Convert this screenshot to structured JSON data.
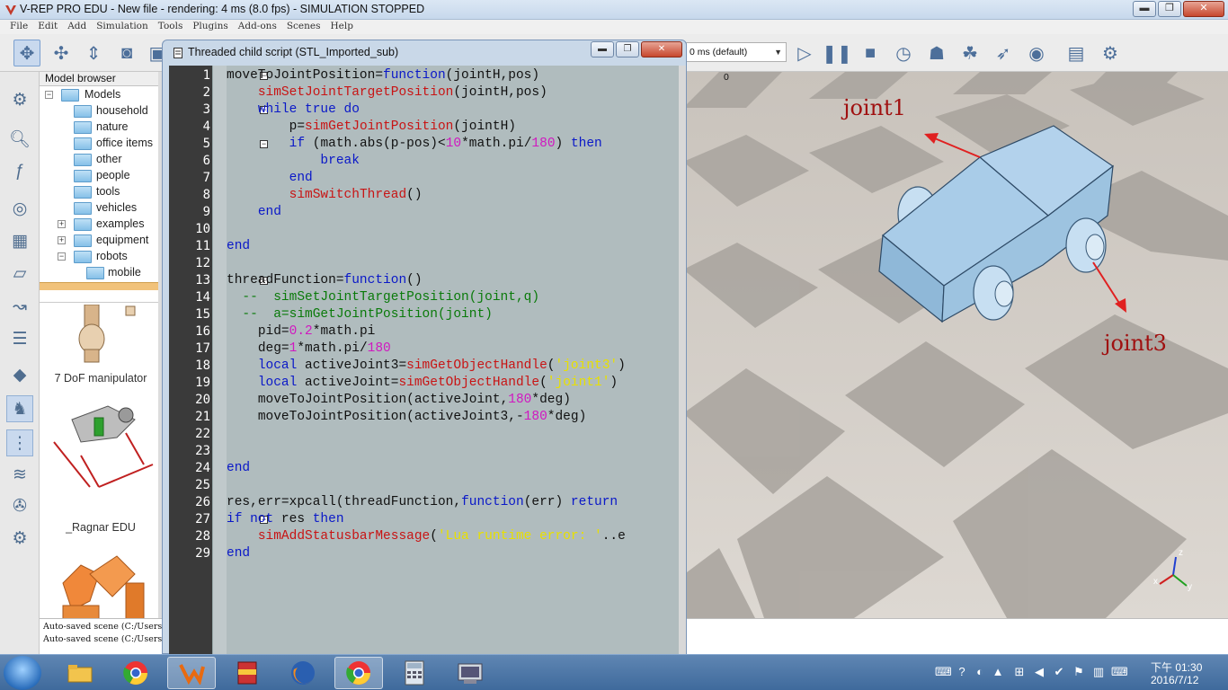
{
  "window": {
    "title": "V-REP PRO EDU - New file - rendering: 4 ms (8.0 fps) - SIMULATION STOPPED",
    "min_glyph": "▬",
    "max_glyph": "❐",
    "close_glyph": "✕"
  },
  "menu": [
    "File",
    "Edit",
    "Add",
    "Simulation",
    "Tools",
    "Plugins",
    "Add-ons",
    "Scenes",
    "Help"
  ],
  "toolbar": {
    "timestep_value": "0 ms (default)",
    "icons": [
      "move-icon",
      "object-shift-icon",
      "object-rotate-icon",
      "camera-icon",
      "play-icon",
      "pause-icon",
      "stop-icon",
      "realtime-icon",
      "slow-icon",
      "fast-icon",
      "threaded-icon",
      "visualization-icon",
      "scene-objects-icon",
      "selection-icon"
    ]
  },
  "model_browser": {
    "header": "Model browser",
    "tree": [
      {
        "label": "Models",
        "level": 0,
        "expander": "−"
      },
      {
        "label": "household",
        "level": 1
      },
      {
        "label": "nature",
        "level": 1
      },
      {
        "label": "office items",
        "level": 1
      },
      {
        "label": "other",
        "level": 1
      },
      {
        "label": "people",
        "level": 1
      },
      {
        "label": "tools",
        "level": 1
      },
      {
        "label": "vehicles",
        "level": 1
      },
      {
        "label": "examples",
        "level": 1,
        "expander": "+"
      },
      {
        "label": "equipment",
        "level": 1,
        "expander": "+"
      },
      {
        "label": "robots",
        "level": 1,
        "expander": "−"
      },
      {
        "label": "mobile",
        "level": 2
      }
    ],
    "thumbnails": [
      "7 DoF manipulator",
      "_Ragnar EDU"
    ]
  },
  "status_lines": [
    "Auto-saved scene (C:/Users/use",
    "Auto-saved scene (C:/Users/use"
  ],
  "script_window": {
    "title": "Threaded child script (STL_Imported_sub)",
    "line_numbers": [
      "1",
      "2",
      "3",
      "4",
      "5",
      "6",
      "7",
      "8",
      "9",
      "10",
      "11",
      "12",
      "13",
      "14",
      "15",
      "16",
      "17",
      "18",
      "19",
      "20",
      "21",
      "22",
      "23",
      "24",
      "25",
      "26",
      "27",
      "28",
      "29"
    ],
    "fold_markers": [
      "⊟",
      "",
      "⊟",
      "",
      "⊟",
      "",
      "",
      "",
      "",
      "",
      "",
      "",
      "⊟",
      "",
      "",
      "",
      "",
      "",
      "",
      "",
      "",
      "",
      "",
      "",
      "",
      "",
      "⊟",
      "",
      ""
    ],
    "code_lines": [
      "moveToJointPosition=function(jointH,pos)",
      "    simSetJointTargetPosition(jointH,pos)",
      "    while true do",
      "        p=simGetJointPosition(jointH)",
      "        if (math.abs(p-pos)<10*math.pi/180) then",
      "            break",
      "        end",
      "        simSwitchThread()",
      "    end",
      "",
      "end",
      "",
      "threadFunction=function()",
      "  --  simSetJointTargetPosition(joint,q)",
      "  --  a=simGetJointPosition(joint)",
      "    pid=0.2*math.pi",
      "    deg=1*math.pi/180",
      "    local activeJoint3=simGetObjectHandle('joint3')",
      "    local activeJoint=simGetObjectHandle('joint1')",
      "    moveToJointPosition(activeJoint,180*deg)",
      "    moveToJointPosition(activeJoint3,-180*deg)",
      "",
      "",
      "end",
      "",
      "res,err=xpcall(threadFunction,function(err) return",
      "if not res then",
      "    simAddStatusbarMessage('Lua runtime error: '..e",
      "end"
    ]
  },
  "scene": {
    "zero_label": "0",
    "joint1_label": "joint1",
    "joint3_label": "joint3",
    "axis_x": "x",
    "axis_y": "y",
    "axis_z": "z"
  },
  "taskbar": {
    "apps": [
      "explorer",
      "chrome",
      "vrep",
      "winrar",
      "firefox",
      "chrome-active",
      "calculator",
      "network"
    ],
    "time": "下午 01:30",
    "date": "2016/7/12"
  },
  "colors": {
    "keyword": "#0a18c8",
    "function": "#c81414",
    "number": "#d018c0",
    "string": "#e8e000",
    "comment": "#0a7a0a",
    "annotation": "#a01010"
  }
}
